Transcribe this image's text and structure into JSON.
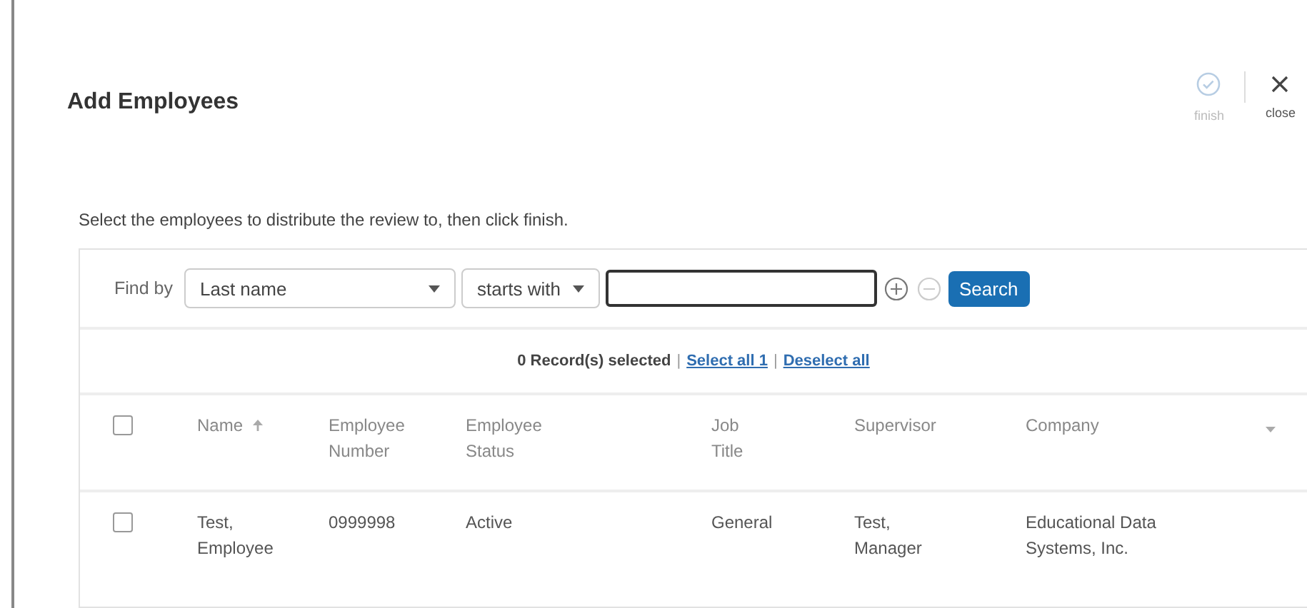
{
  "dialog": {
    "title": "Add Employees",
    "actions": [
      {
        "kind": "finish",
        "label": "finish",
        "disabled": true
      },
      {
        "kind": "close",
        "label": "close",
        "disabled": false
      }
    ]
  },
  "instruction": "Select the employees to distribute the review to, then click finish.",
  "filter": {
    "label": "Find by",
    "field": "Last name",
    "operator": "starts with",
    "search_button": "Search"
  },
  "selection": {
    "count_text": "0 Record(s) selected",
    "separator": "|",
    "select_all": "Select all 1",
    "deselect_all": "Deselect all"
  },
  "table": {
    "columns": [
      {
        "label": "Name",
        "sorted": true
      },
      {
        "label": "Employee Number",
        "sorted": false
      },
      {
        "label": "Employee Status",
        "sorted": false
      },
      {
        "label": "Job Title",
        "sorted": false
      },
      {
        "label": "Supervisor",
        "sorted": false
      },
      {
        "label": "Company",
        "sorted": false
      }
    ],
    "all_checked": false,
    "rows": [
      {
        "checked": false,
        "cells": [
          "Test, Employee",
          "0999998",
          "Active",
          "General",
          "Test, Manager",
          "Educational Data Systems, Inc."
        ]
      }
    ]
  }
}
